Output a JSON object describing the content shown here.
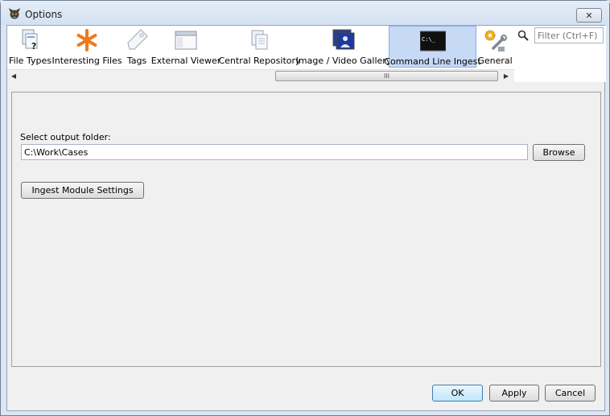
{
  "window": {
    "title": "Options",
    "close_glyph": "✕"
  },
  "tabs": [
    {
      "label": "File Types",
      "icon": "file-types-icon"
    },
    {
      "label": "Interesting Files",
      "icon": "asterisk-icon"
    },
    {
      "label": "Tags",
      "icon": "tag-icon"
    },
    {
      "label": "External Viewer",
      "icon": "window-icon"
    },
    {
      "label": "Central Repository",
      "icon": "documents-icon"
    },
    {
      "label": "Image / Video Gallery",
      "icon": "gallery-icon"
    },
    {
      "label": "Command Line Ingest",
      "icon": "terminal-icon",
      "selected": true
    },
    {
      "label": "General",
      "icon": "gears-icon"
    }
  ],
  "terminal_icon_text": "C:\\_",
  "scroll": {
    "left": "◀",
    "right": "▶",
    "grip": "III"
  },
  "filter": {
    "placeholder": "Filter (Ctrl+F)"
  },
  "content": {
    "output_label": "Select output folder:",
    "output_path": "C:\\Work\\Cases",
    "browse_label": "Browse",
    "ingest_settings_label": "Ingest Module Settings"
  },
  "footer": {
    "ok_label": "OK",
    "apply_label": "Apply",
    "cancel_label": "Cancel"
  },
  "colors": {
    "accent_orange": "#f07a1a",
    "selected_tab_bg": "#c6d9f5"
  }
}
